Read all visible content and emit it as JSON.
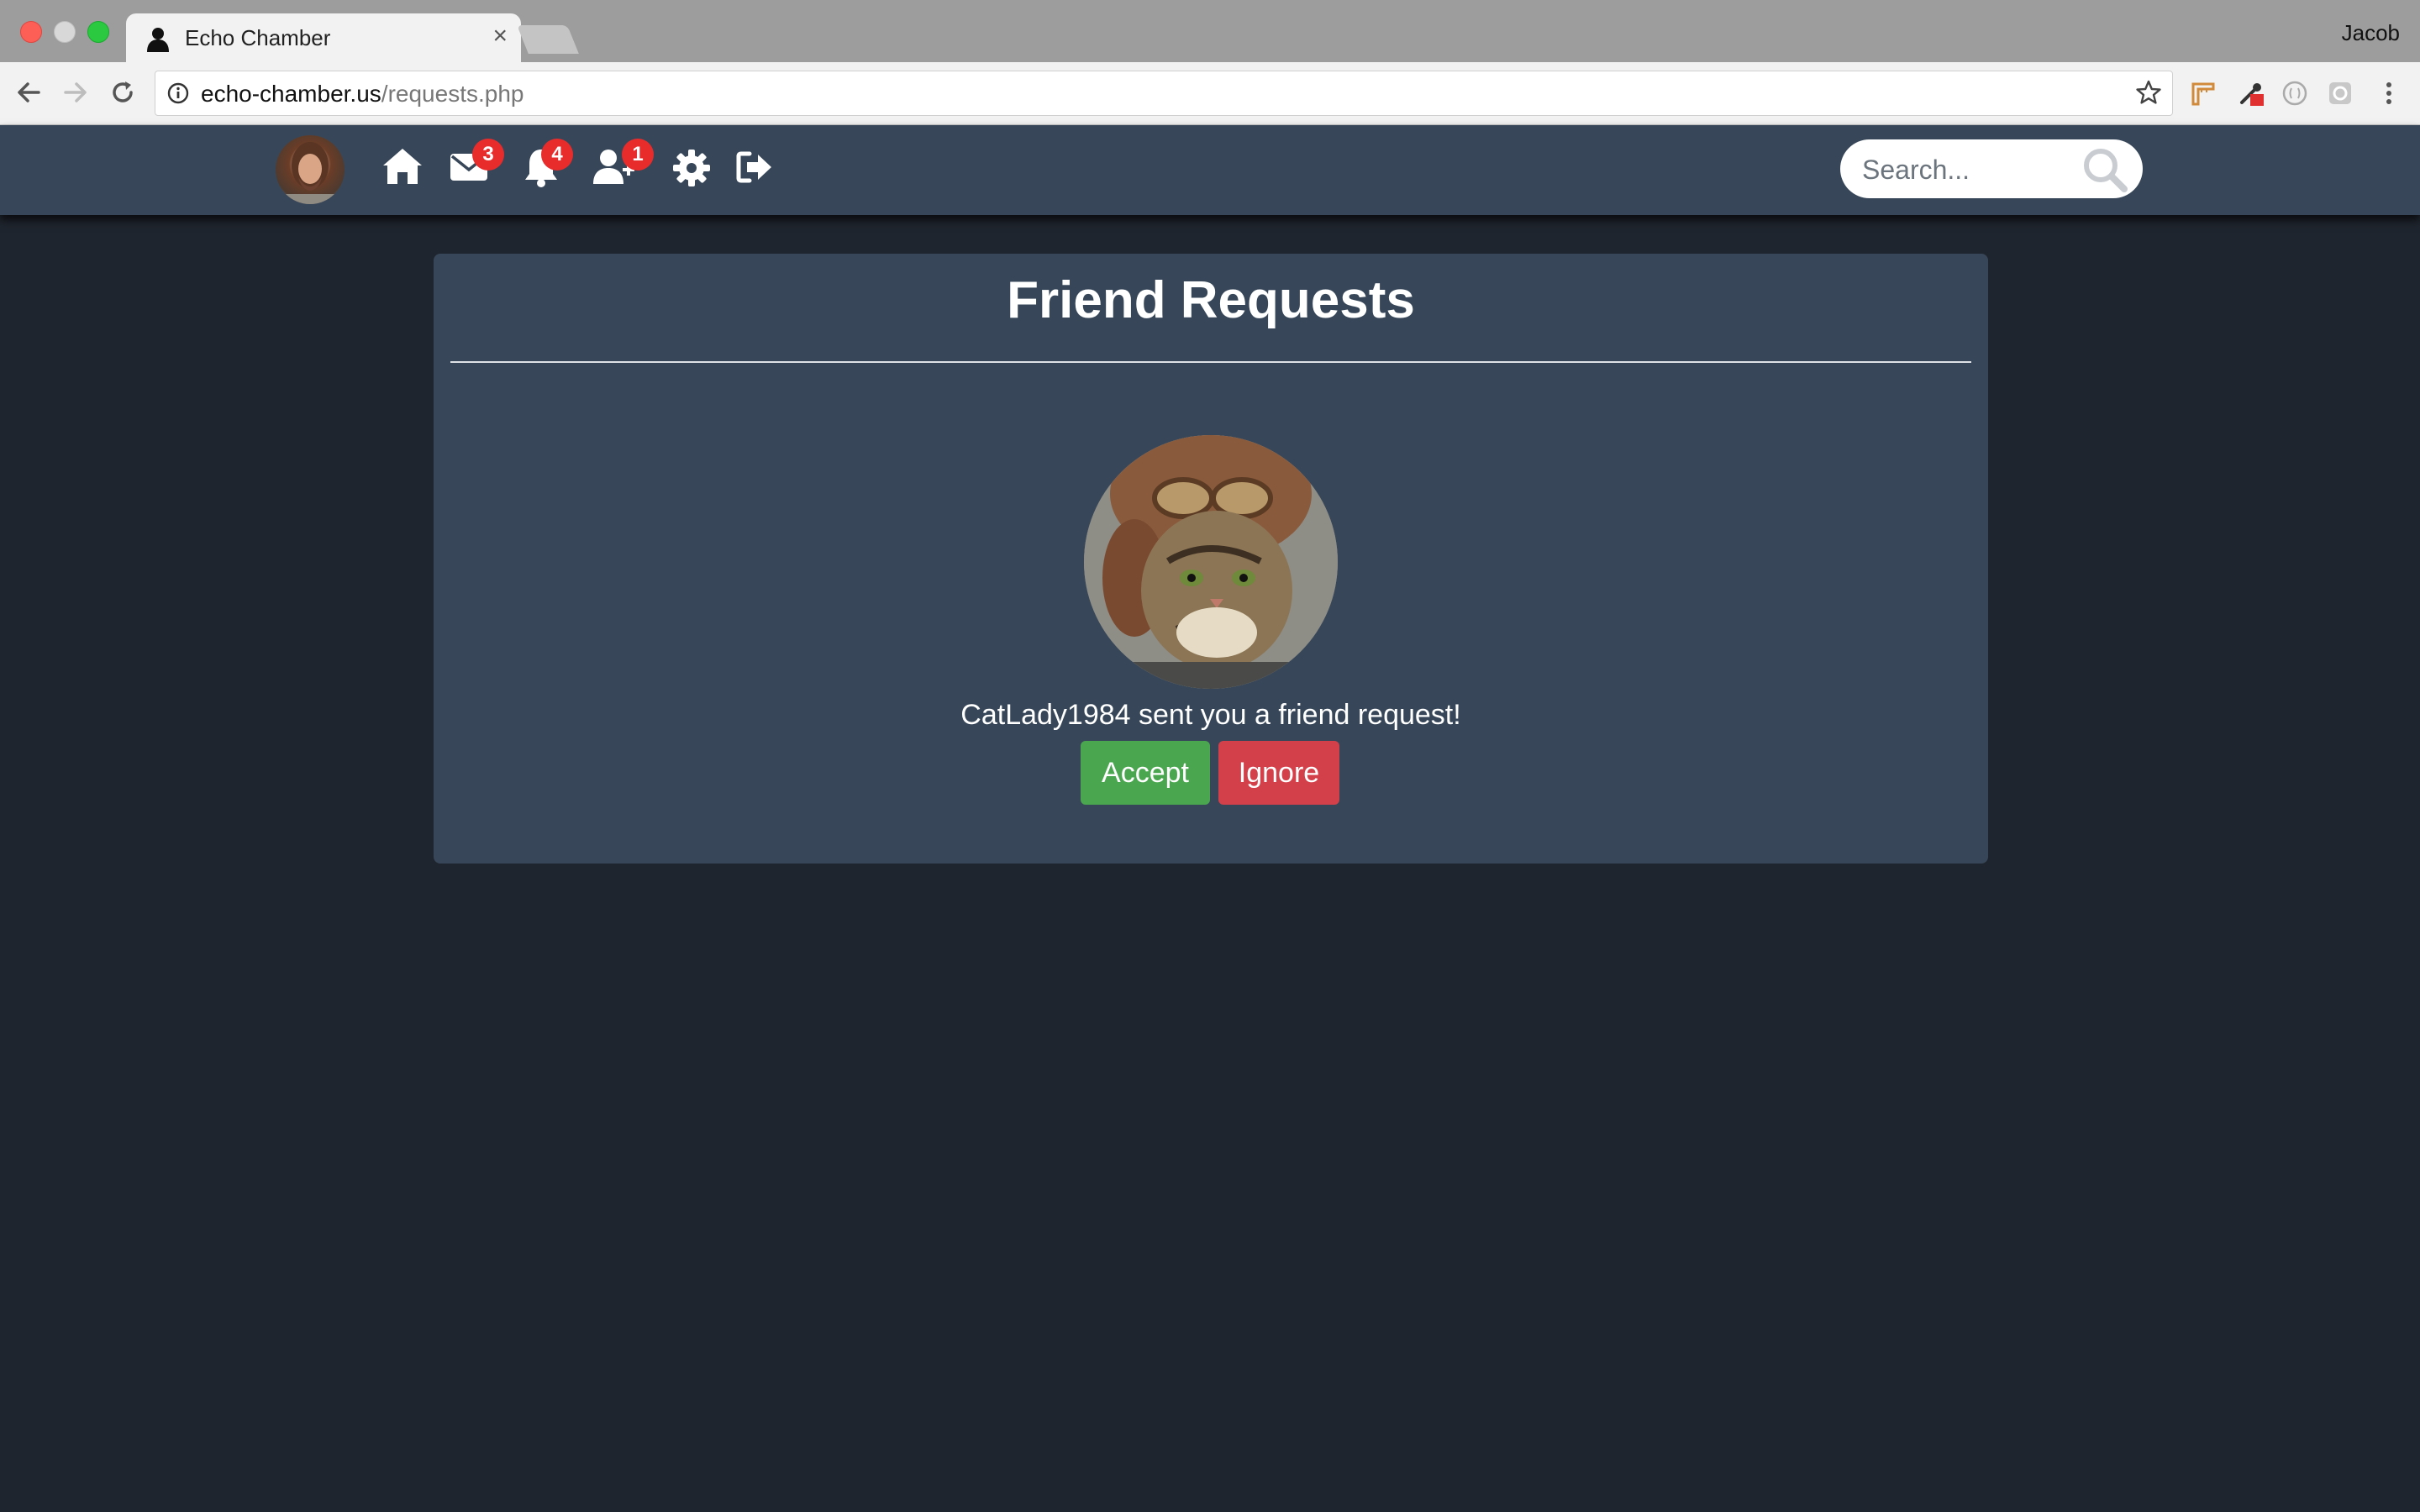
{
  "browser": {
    "tab_title": "Echo Chamber",
    "tab_close": "×",
    "profile_name": "Jacob",
    "url_host": "echo-chamber.us",
    "url_path": "/requests.php"
  },
  "navbar": {
    "messages_count": "3",
    "notifications_count": "4",
    "friend_requests_count": "1",
    "search_placeholder": "Search..."
  },
  "main": {
    "title": "Friend Requests",
    "request": {
      "message": "CatLady1984 sent you a friend request!",
      "accept_label": "Accept",
      "ignore_label": "Ignore"
    }
  },
  "colors": {
    "page_bg": "#1f252e",
    "panel_bg": "#374759",
    "accept": "#4aa64f",
    "ignore": "#d3404a",
    "badge": "#e82c2c"
  },
  "icons": [
    "home-icon",
    "envelope-icon",
    "bell-icon",
    "user-plus-icon",
    "gear-icon",
    "sign-out-icon",
    "search-icon"
  ]
}
